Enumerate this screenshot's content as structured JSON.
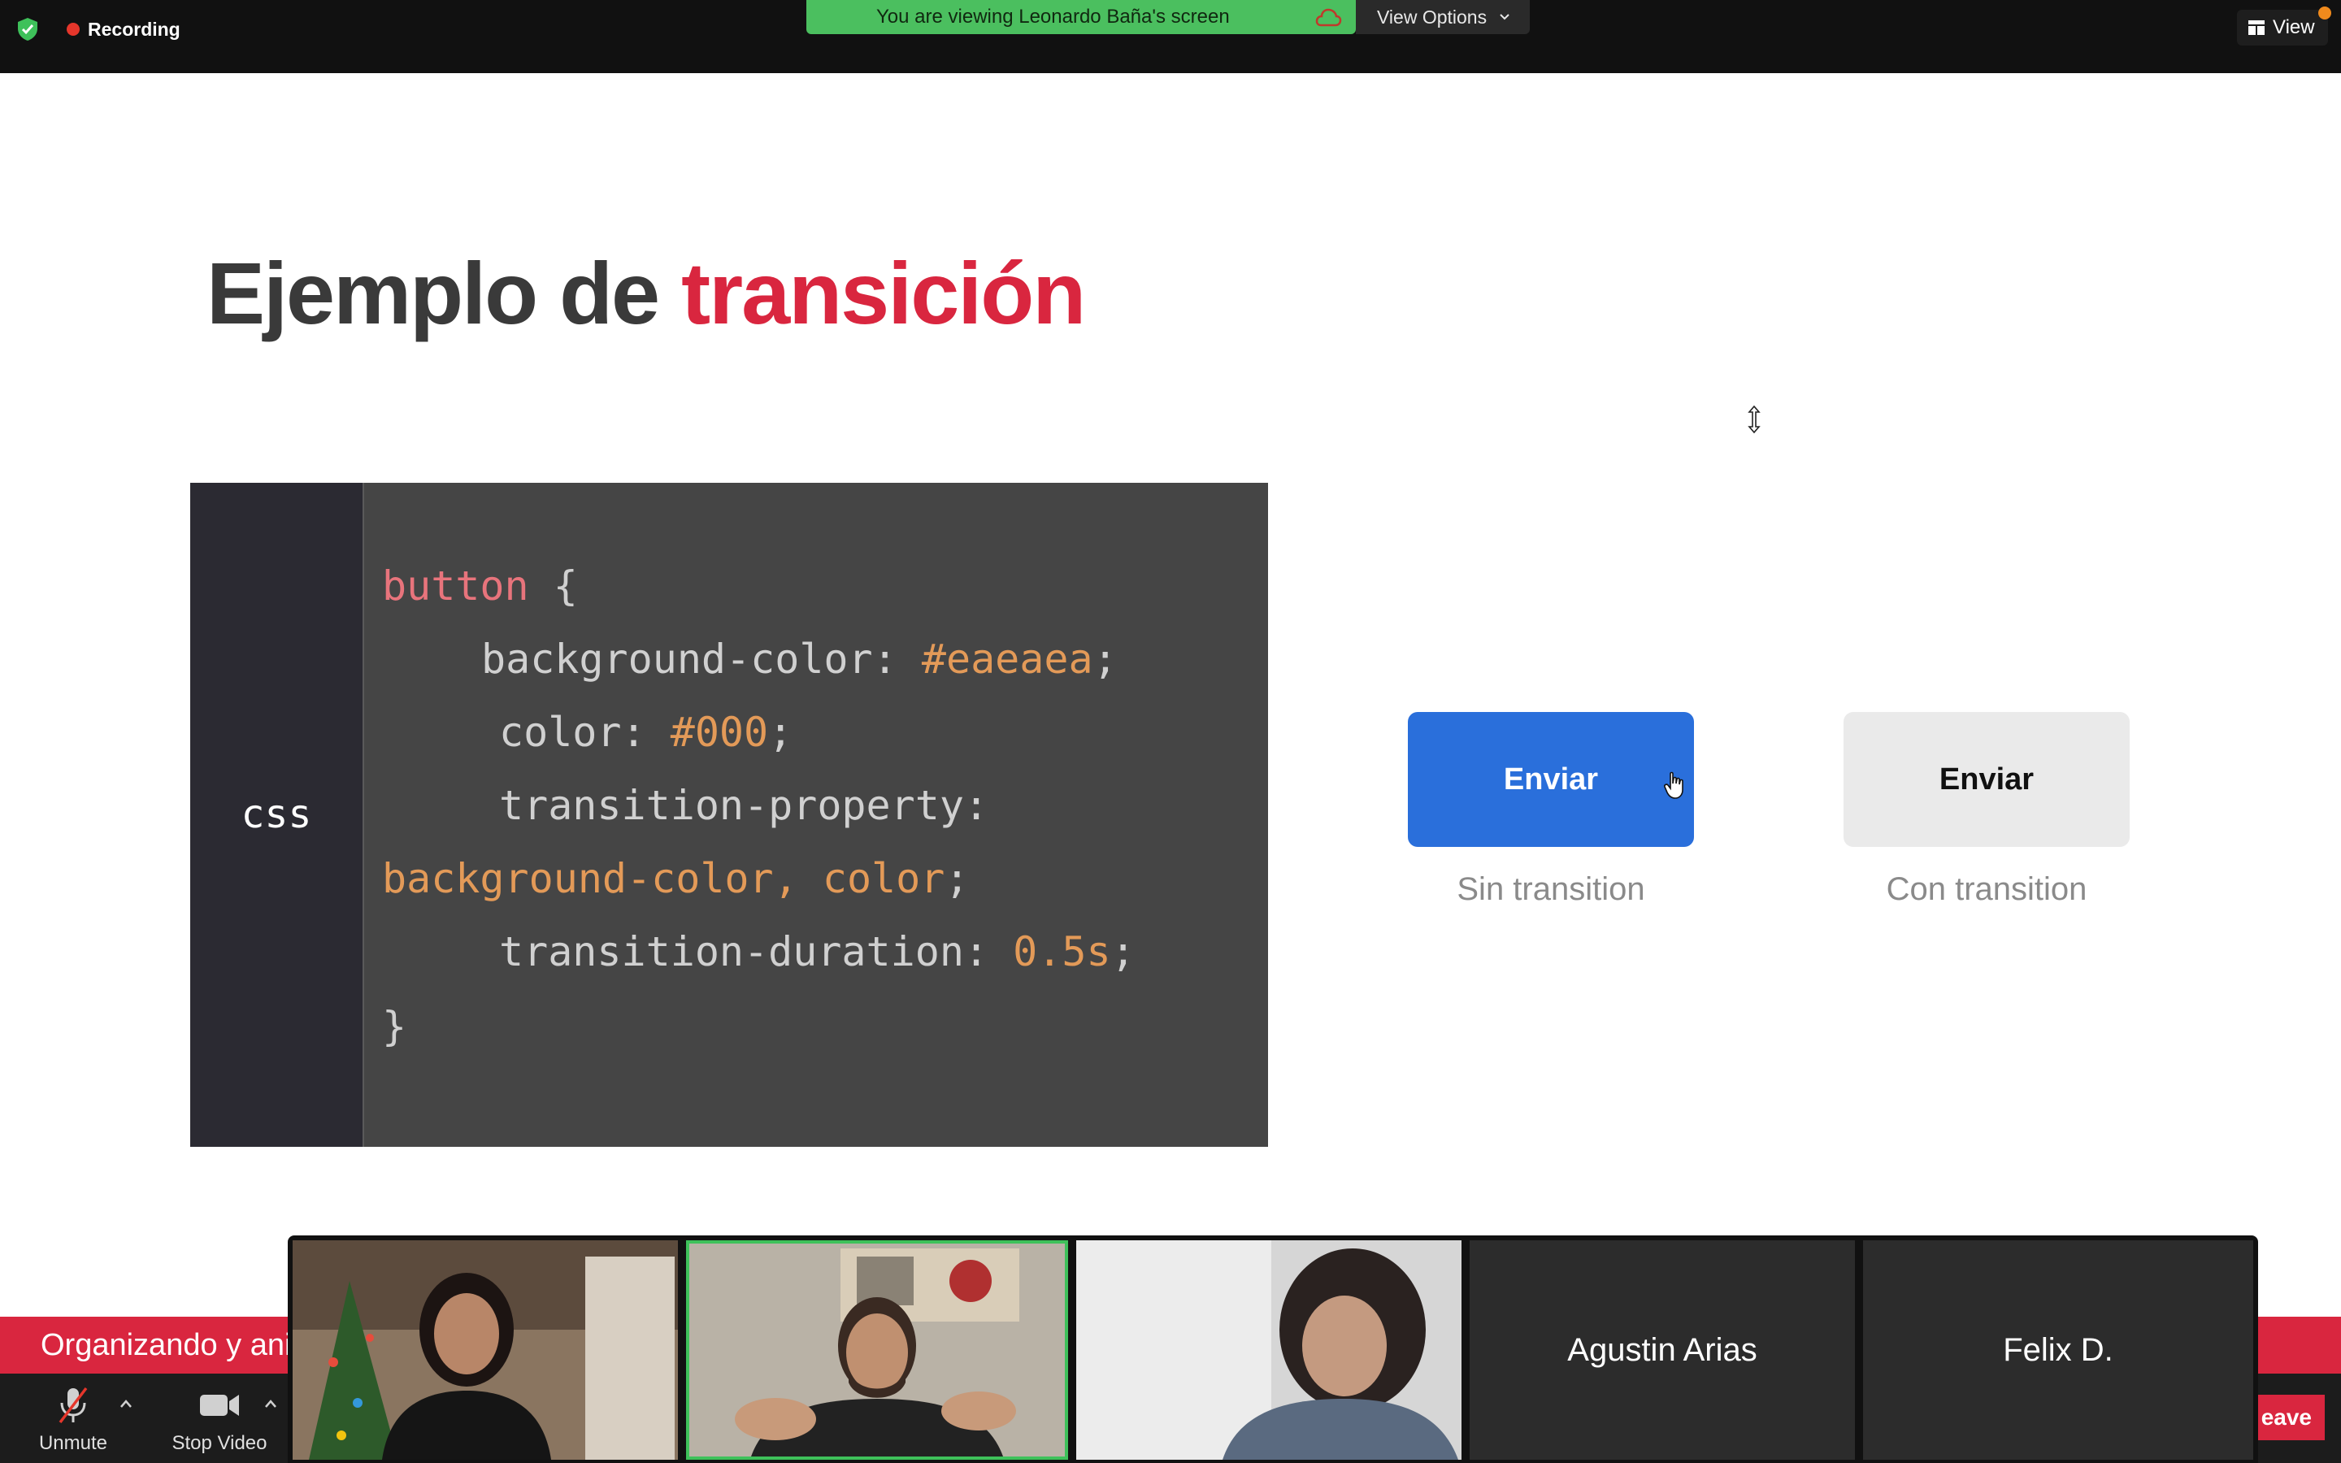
{
  "topbar": {
    "recording_label": "Recording",
    "viewing_text": "You are viewing Leonardo Baña's screen",
    "view_options_label": "View Options",
    "view_label": "View"
  },
  "slide": {
    "title_part1": "Ejemplo de ",
    "title_part2": "transición",
    "code_language": "css",
    "code": {
      "l1_sel": "button",
      "l1_brace": " {",
      "l2_prop": "background-color: ",
      "l2_val": "#eaeaea",
      "l2_end": ";",
      "l3_prop": "color: ",
      "l3_val": "#000",
      "l3_end": ";",
      "l4_prop": "transition-property:",
      "l5_val": "background-color, color",
      "l5_end": ";",
      "l6_prop": "transition-duration: ",
      "l6_val": "0.5s",
      "l6_end": ";",
      "l7": "}"
    },
    "demo": {
      "button1_label": "Enviar",
      "button1_caption": "Sin transition",
      "button2_label": "Enviar",
      "button2_caption": "Con transition"
    }
  },
  "ticker": {
    "text": "Organizando y ani"
  },
  "controls": {
    "unmute_label": "Unmute",
    "stop_video_label": "Stop Video",
    "leave_label": "eave"
  },
  "participants": [
    {
      "name": "Agustin Arias"
    },
    {
      "name": "Felix D."
    }
  ],
  "colors": {
    "accent_red": "#d9263f",
    "banner_green": "#4bbf5f",
    "button_blue": "#2a6fdb",
    "active_speaker": "#3ec15a"
  }
}
